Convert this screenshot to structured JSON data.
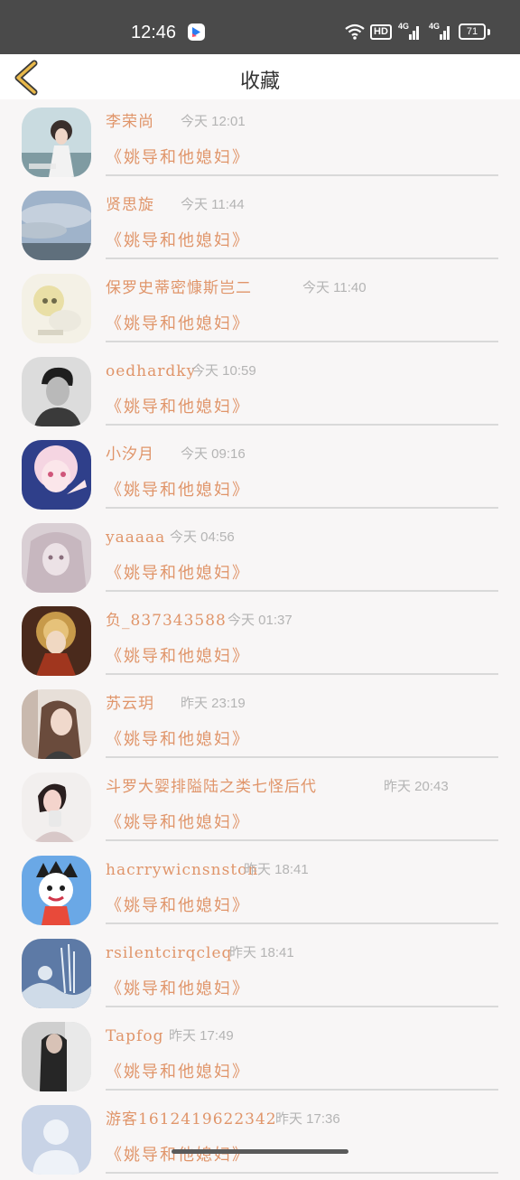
{
  "status_bar": {
    "time": "12:46",
    "hd": "HD",
    "net1": "4G",
    "net2": "4G",
    "battery": "71"
  },
  "header": {
    "title": "收藏"
  },
  "favorites": [
    {
      "name": "李荣尚",
      "time": "今天 12:01",
      "title": "《姚导和他媳妇》"
    },
    {
      "name": "贤思旋",
      "time": "今天 11:44",
      "title": "《姚导和他媳妇》"
    },
    {
      "name": "保罗史蒂密慷斯岂二",
      "time": "今天 11:40",
      "title": "《姚导和他媳妇》"
    },
    {
      "name": "oedhardky",
      "time": "今天 10:59",
      "title": "《姚导和他媳妇》"
    },
    {
      "name": "小汐月",
      "time": "今天 09:16",
      "title": "《姚导和他媳妇》"
    },
    {
      "name": "yaaaaa",
      "time": "今天 04:56",
      "title": "《姚导和他媳妇》"
    },
    {
      "name": "负_837343588",
      "time": "今天 01:37",
      "title": "《姚导和他媳妇》"
    },
    {
      "name": "苏云玥",
      "time": "昨天 23:19",
      "title": "《姚导和他媳妇》"
    },
    {
      "name": "斗罗大婴排隘陆之类七怪后代",
      "time": "昨天 20:43",
      "title": "《姚导和他媳妇》"
    },
    {
      "name": "hacrrywicnsnston",
      "time": "昨天 18:41",
      "title": "《姚导和他媳妇》"
    },
    {
      "name": "rsilentcirqcleq",
      "time": "昨天 18:41",
      "title": "《姚导和他媳妇》"
    },
    {
      "name": "Tapfog",
      "time": "昨天 17:49",
      "title": "《姚导和他媳妇》"
    },
    {
      "name": "游客1612419622342",
      "time": "昨天 17:36",
      "title": "《姚导和他媳妇》"
    }
  ],
  "colors": {
    "accent": "#e0956a",
    "time_text": "#b4b4b4",
    "background": "#f8f6f6",
    "status_bar": "#4a4a4a",
    "back_icon": "#e8b84a"
  }
}
